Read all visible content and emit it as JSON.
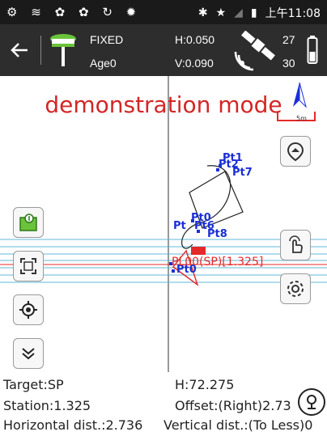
{
  "status_bar": {
    "icons": [
      "settings-icon",
      "wifi-icon",
      "sync-icon",
      "sync-icon",
      "refresh-icon",
      "bug-icon"
    ],
    "right_icons": [
      "bluetooth-icon",
      "star-icon",
      "signal-icon",
      "battery-icon"
    ],
    "time": "上午11:08"
  },
  "toolbar": {
    "back_icon": "back-arrow-icon",
    "fix_status": "FIXED",
    "age": "Age0",
    "h_precision": "H:0.050",
    "v_precision": "V:0.090",
    "satellites_used": "27",
    "satellites_tracked": "30"
  },
  "map": {
    "mode_label": "demonstration mode",
    "scale_label": "5m",
    "north_label": "N",
    "points": [
      "Pt1",
      "Pt2",
      "Pt7",
      "Pt0",
      "Pt8",
      "Pt",
      "Pt6",
      "Pt0"
    ],
    "target_label": "PL00(SP)[1.325]",
    "colors": {
      "point": "#1b2fd6",
      "target": "#e52929",
      "line": "#60b8d8"
    }
  },
  "buttons": {
    "map_layers": "map-pin-icon",
    "fit_view": "fit-screen-icon",
    "locate": "crosshair-icon",
    "collapse": "chevron-double-down-icon",
    "hand": "hand-pointer-icon",
    "settings": "gear-icon",
    "nav": "navigation-up-icon",
    "stakeout": "location-pin-icon"
  },
  "info": {
    "target": "Target:SP",
    "h": "H:72.275",
    "station": "Station:1.325",
    "offset": "Offset:(Right)2.73",
    "horizontal": "Horizontal dist.:2.736",
    "vertical": "Vertical dist.:(To Less)0"
  }
}
